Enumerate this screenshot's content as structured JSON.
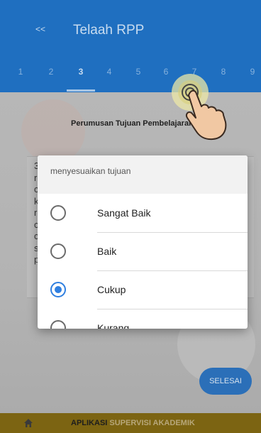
{
  "header": {
    "back_label": "<<",
    "title": "Telaah RPP"
  },
  "tabs": [
    "1",
    "2",
    "3",
    "4",
    "5",
    "6",
    "7",
    "8",
    "9"
  ],
  "active_tab": "3",
  "section": {
    "title": "Perumusan Tujuan Pembelajaran"
  },
  "background_text": {
    "letters": [
      "3",
      "r",
      "c",
      "k",
      "r",
      "c",
      "c",
      "s",
      "p"
    ]
  },
  "dialog": {
    "title": "menyesuaikan tujuan",
    "options": [
      {
        "label": "Sangat Baik",
        "selected": false
      },
      {
        "label": "Baik",
        "selected": false
      },
      {
        "label": "Cukup",
        "selected": true
      },
      {
        "label": "Kurang",
        "selected": false
      }
    ]
  },
  "actions": {
    "finish_label": "SELESAI"
  },
  "footer": {
    "brand_part1": "APLIKASI",
    "brand_part2": "SUPERVISI AKADEMIK",
    "home_icon": "home-icon"
  },
  "colors": {
    "primary": "#1f6fc0",
    "radio_selected": "#2f7fe0",
    "footer": "#7c6412",
    "brand_accent": "#b7a77a"
  }
}
